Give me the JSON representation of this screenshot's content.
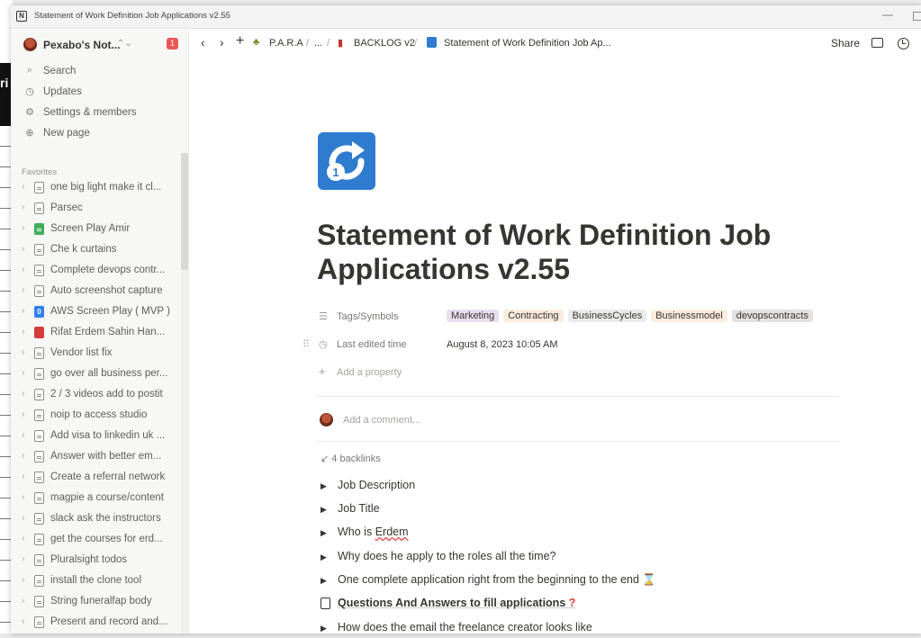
{
  "window": {
    "title": "Statement of Work Definition Job Applications v2.55",
    "app_icon": "N",
    "minimize": "—"
  },
  "background": {
    "partial_text": "ri"
  },
  "workspace": {
    "name": "Pexabo's Not...",
    "chevron": "⌃⌄",
    "badge": "1"
  },
  "nav": [
    {
      "label": "Search",
      "icon": "search-icon"
    },
    {
      "label": "Updates",
      "icon": "clock-icon"
    },
    {
      "label": "Settings & members",
      "icon": "gear-icon"
    },
    {
      "label": "New page",
      "icon": "plus-circle-icon"
    }
  ],
  "favorites": {
    "title": "Favorites",
    "items": [
      {
        "label": "one big light make it cl...",
        "icon": "page"
      },
      {
        "label": "Parsec",
        "icon": "page"
      },
      {
        "label": "Screen Play Amir",
        "icon": "green"
      },
      {
        "label": "Che k curtains",
        "icon": "page"
      },
      {
        "label": "Complete devops contr...",
        "icon": "page"
      },
      {
        "label": "Auto screenshot capture",
        "icon": "page"
      },
      {
        "label": "AWS Screen Play ( MVP )",
        "icon": "blue"
      },
      {
        "label": "Rifat Erdem Sahin Han...",
        "icon": "red"
      },
      {
        "label": "Vendor list fix",
        "icon": "page"
      },
      {
        "label": "go over all business per...",
        "icon": "page"
      },
      {
        "label": "2 / 3 videos add to postit",
        "icon": "page"
      },
      {
        "label": "noip to access studio",
        "icon": "page"
      },
      {
        "label": "Add visa to linkedin uk ...",
        "icon": "page"
      },
      {
        "label": "Answer with better em...",
        "icon": "page"
      },
      {
        "label": "Create a referral network",
        "icon": "page"
      },
      {
        "label": "magpie a course/content",
        "icon": "page"
      },
      {
        "label": "slack ask the instructors",
        "icon": "page"
      },
      {
        "label": "get the courses for erd...",
        "icon": "page"
      },
      {
        "label": "Pluralsight todos",
        "icon": "page"
      },
      {
        "label": "install the clone tool",
        "icon": "page"
      },
      {
        "label": "String funeralfap body",
        "icon": "page"
      },
      {
        "label": "Present and record and...",
        "icon": "page"
      }
    ]
  },
  "breadcrumb": {
    "items": [
      "P.A.R.A",
      "...",
      "BACKLOG v2",
      "Statement of Work Definition Job Ap..."
    ],
    "separator": "/"
  },
  "topbar": {
    "share": "Share"
  },
  "page": {
    "title": "Statement of Work Definition Job Applications v2.55",
    "properties": {
      "tags_label": "Tags/Symbols",
      "tags": [
        {
          "label": "Marketing",
          "color": "#e8deee"
        },
        {
          "label": "Contracting",
          "color": "#fbecdd"
        },
        {
          "label": "BusinessCycles",
          "color": "#ebebea"
        },
        {
          "label": "Businessmodel",
          "color": "#fbecdd"
        },
        {
          "label": "devopscontracts",
          "color": "#e3e2e0"
        }
      ],
      "edited_label": "Last edited time",
      "edited_value": "August 8, 2023 10:05 AM",
      "add_property": "Add a property"
    },
    "comment_placeholder": "Add a comment...",
    "backlinks": "4 backlinks",
    "blocks": [
      {
        "text": "Job Description"
      },
      {
        "text": "Job Title"
      },
      {
        "text_a": "Who is ",
        "text_b": "Erdem"
      },
      {
        "text": "Why does he apply to the roles all the time?"
      },
      {
        "text": "One complete application right from the beginning to the end",
        "emoji": "⌛"
      },
      {
        "text": "Questions And Answers to fill applications",
        "emoji": "?"
      },
      {
        "text": "How does the email the freelance creator looks like"
      }
    ]
  }
}
